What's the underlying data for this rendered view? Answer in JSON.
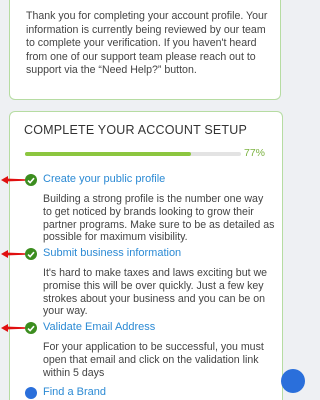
{
  "notice": {
    "text": "Thank you for completing your account profile. Your information is currently being reviewed by our team to complete your verification. If you haven't heard from one of our support team please reach out to support via the “Need Help?” button."
  },
  "setup": {
    "title": "COMPLETE YOUR ACCOUNT SETUP",
    "progress_percent": 77,
    "progress_label": "77%",
    "steps": [
      {
        "title": "Create your public profile",
        "status": "complete",
        "description": "Building a strong profile is the number one way to get noticed by brands looking to grow their partner programs. Make sure to be as detailed as possible for maximum visibility."
      },
      {
        "title": "Submit business information",
        "status": "complete",
        "description": "It's hard to make taxes and laws exciting but we promise this will be over quickly. Just a few key strokes about your business and you can be on your way."
      },
      {
        "title": "Validate Email Address",
        "status": "complete",
        "description": "For your application to be successful, you must open that email and click on the validation link within 5 days"
      },
      {
        "title": "Find a Brand",
        "status": "incomplete",
        "description": ""
      }
    ]
  },
  "colors": {
    "accent": "#8cc63f",
    "link": "#2b8ad4",
    "complete": "#3c8d1f",
    "incomplete": "#2a6fdb",
    "annotation_arrow": "#e01010"
  },
  "icons": {
    "complete": "check-circle-icon",
    "incomplete": "dot-circle-icon",
    "annotation": "red-arrow-icon",
    "help": "help-button-icon"
  }
}
